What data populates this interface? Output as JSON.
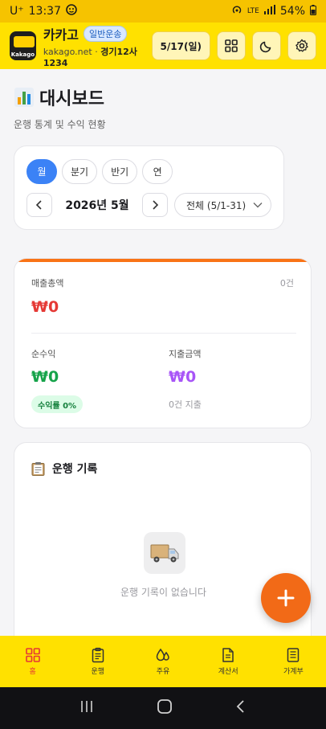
{
  "status_bar": {
    "carrier": "U⁺",
    "time": "13:37",
    "network": "LTE",
    "network_sub": "LTE+",
    "battery": "54%"
  },
  "header": {
    "app_name": "카카고",
    "badge": "일반운송",
    "domain": "kakago.net",
    "separator": " · ",
    "plate": "경기12사1234",
    "logo_text": "Kakago",
    "date_button": "5/17(일)"
  },
  "page": {
    "title": "대시보드",
    "subtitle": "운행 통계 및 수익 현황"
  },
  "period": {
    "tabs": [
      "월",
      "분기",
      "반기",
      "연"
    ],
    "active_tab": 0,
    "current_label": "2026년 5월",
    "range_value": "전체 (5/1-31)"
  },
  "stats": {
    "revenue_label": "매출총액",
    "revenue_count": "0건",
    "revenue_value": "₩0",
    "profit_label": "순수익",
    "profit_value": "₩0",
    "profit_rate": "수익률 0%",
    "expense_label": "지출금액",
    "expense_value": "₩0",
    "expense_count": "0건 지출",
    "colors": {
      "revenue": "#e53935",
      "profit": "#16a34a",
      "expense": "#a855f7",
      "accent": "#f97316"
    }
  },
  "trips": {
    "title": "운행 기록",
    "empty": "운행 기록이 없습니다"
  },
  "bottom_nav": [
    {
      "label": "홈",
      "icon": "home-grid-icon",
      "active": true
    },
    {
      "label": "운행",
      "icon": "clipboard-icon",
      "active": false
    },
    {
      "label": "주유",
      "icon": "fuel-drop-icon",
      "active": false
    },
    {
      "label": "계산서",
      "icon": "invoice-icon",
      "active": false
    },
    {
      "label": "가계부",
      "icon": "ledger-icon",
      "active": false
    }
  ]
}
